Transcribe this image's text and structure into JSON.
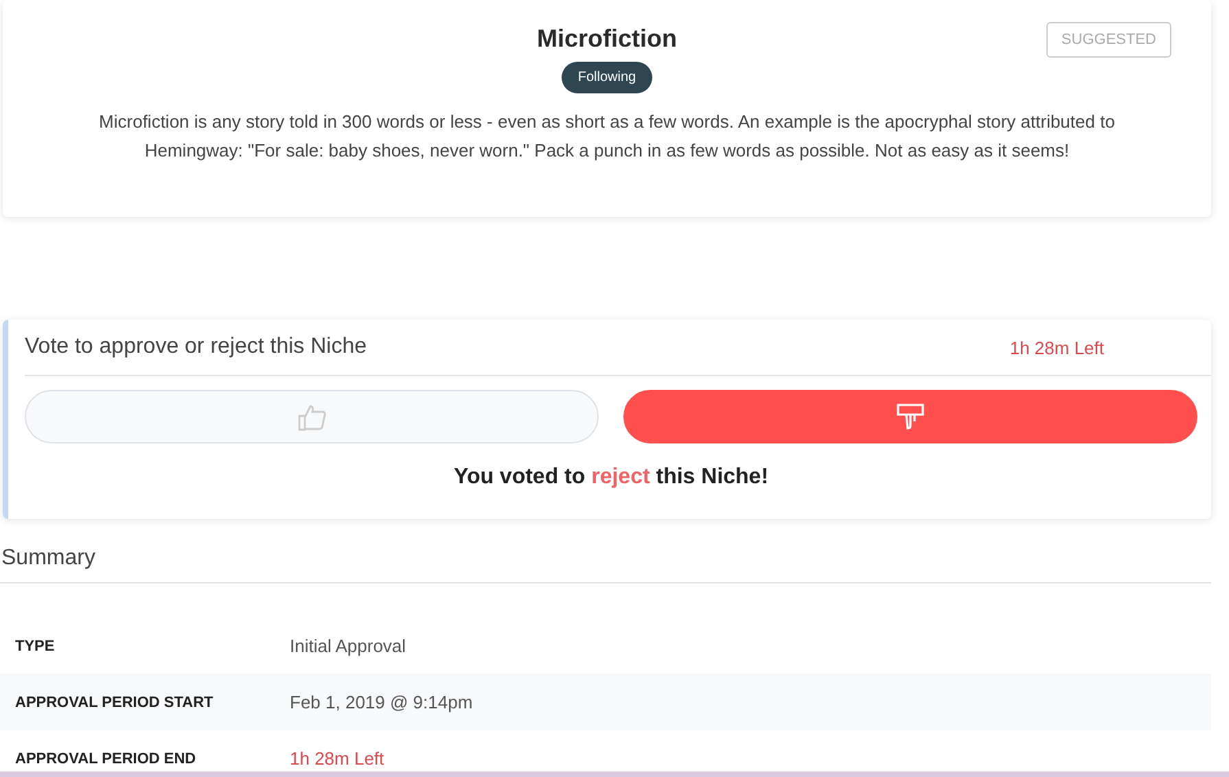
{
  "niche": {
    "title": "Microfiction",
    "status_badge": "SUGGESTED",
    "follow_button": {
      "label": "Following",
      "selected": true
    },
    "description": "Microfiction is any story told in 300 words or less - even as short as a few words. An example is the apocryphal story attributed to Hemingway: \"For sale: baby shoes, never worn.\" Pack a punch in as few words as possible. Not as easy as it seems!"
  },
  "vote": {
    "prompt": "Vote to approve or reject this Niche",
    "time_left": "1h  28m  Left",
    "options": [
      {
        "kind": "approve",
        "selected": false
      },
      {
        "kind": "reject",
        "selected": true
      }
    ],
    "result": {
      "before": "You voted to ",
      "choice": "reject",
      "after": " this Niche!"
    }
  },
  "summary": {
    "title": "Summary",
    "rows": [
      {
        "label": "TYPE",
        "value": "Initial Approval",
        "kind": "text"
      },
      {
        "label": "APPROVAL PERIOD START",
        "value": "Feb 1, 2019 @ 9:14pm",
        "kind": "text"
      },
      {
        "label": "APPROVAL PERIOD END",
        "value": "1h  28m  Left",
        "kind": "countdown"
      }
    ]
  }
}
